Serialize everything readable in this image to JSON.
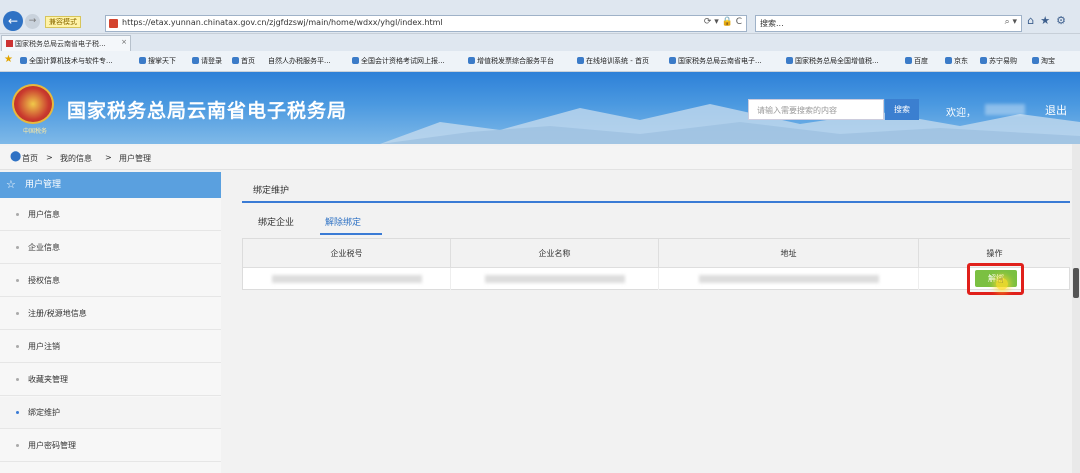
{
  "browser": {
    "compat_label": "兼容模式",
    "url": "https://etax.yunnan.chinatax.gov.cn/zjgfdzswj/main/home/wdxx/yhgl/index.html",
    "address_tools": "⟳ ▾ 🔒 C",
    "search_placeholder": "搜索...",
    "tab_title": "国家税务总局云南省电子税...",
    "bookmarks": [
      "全国计算机技术与软件专...",
      "搜掌天下",
      "请登录",
      "首页",
      "自然人办税服务平...",
      "全国会计资格考试网上报...",
      "增值税发票综合服务平台",
      "在线培训系统 - 首页",
      "国家税务总局云南省电子...",
      "国家税务总局全国增值税...",
      "百度",
      "京东",
      "苏宁易购",
      "淘宝"
    ]
  },
  "header": {
    "site_title": "国家税务总局云南省电子税务局",
    "emblem_caption": "中国税务",
    "search_placeholder": "请输入需要搜索的内容",
    "search_button": "搜索",
    "welcome": "欢迎，",
    "logout": "退出"
  },
  "breadcrumb": [
    "首页",
    ">",
    "我的信息",
    ">",
    "用户管理"
  ],
  "sidebar": {
    "title": "用户管理",
    "items": [
      {
        "label": "用户信息"
      },
      {
        "label": "企业信息"
      },
      {
        "label": "授权信息"
      },
      {
        "label": "注册/税源地信息"
      },
      {
        "label": "用户注销"
      },
      {
        "label": "收藏夹管理"
      },
      {
        "label": "绑定维护"
      },
      {
        "label": "用户密码管理"
      }
    ]
  },
  "main": {
    "section_title": "绑定维护",
    "tabs": [
      "绑定企业",
      "解除绑定"
    ],
    "table": {
      "headers": [
        "企业税号",
        "企业名称",
        "地址",
        "操作"
      ],
      "action_button": "解绑"
    }
  },
  "colors": {
    "accent": "#3a7bd5",
    "unbind": "#7bc042",
    "highlight": "#e0201b"
  }
}
